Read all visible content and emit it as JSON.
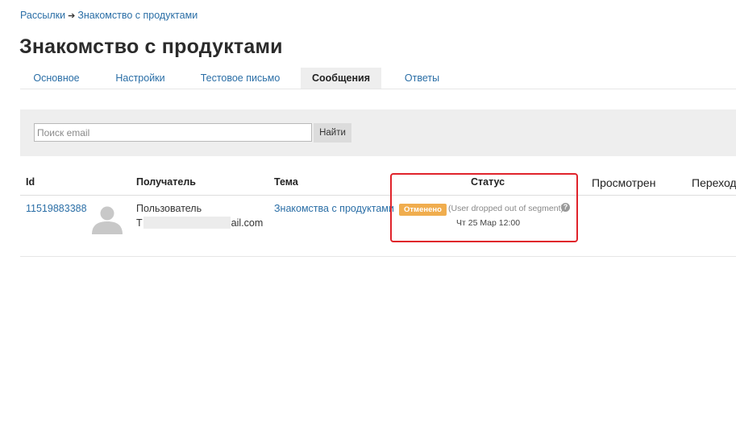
{
  "breadcrumb": {
    "root": "Рассылки",
    "separator": "➔",
    "current": "Знакомство с продуктами"
  },
  "page_title": "Знакомство с продуктами",
  "tabs": [
    {
      "label": "Основное",
      "active": false
    },
    {
      "label": "Настройки",
      "active": false
    },
    {
      "label": "Тестовое письмо",
      "active": false
    },
    {
      "label": "Сообщения",
      "active": true
    },
    {
      "label": "Ответы",
      "active": false
    }
  ],
  "search": {
    "placeholder": "Поиск email",
    "button_label": "Найти"
  },
  "table": {
    "columns": [
      "Id",
      "Получатель",
      "Тема",
      "Статус",
      "Просмотрен",
      "Переход"
    ],
    "rows": [
      {
        "id": "11519883388",
        "recipient_name": "Пользователь",
        "email_start": "T",
        "email_end": "ail.com",
        "subject": "Знакомства с продуктами",
        "status_badge": "Отменено",
        "status_reason": "(User dropped out of segment)",
        "status_date": "Чт 25 Мар 12:00"
      }
    ]
  },
  "colors": {
    "link": "#2a6ea6",
    "badge": "#f0ad4e",
    "highlight": "#e0232b",
    "panel": "#eeeeee"
  },
  "icons": [
    "user-avatar-icon",
    "help-icon",
    "arrow-right-icon"
  ]
}
